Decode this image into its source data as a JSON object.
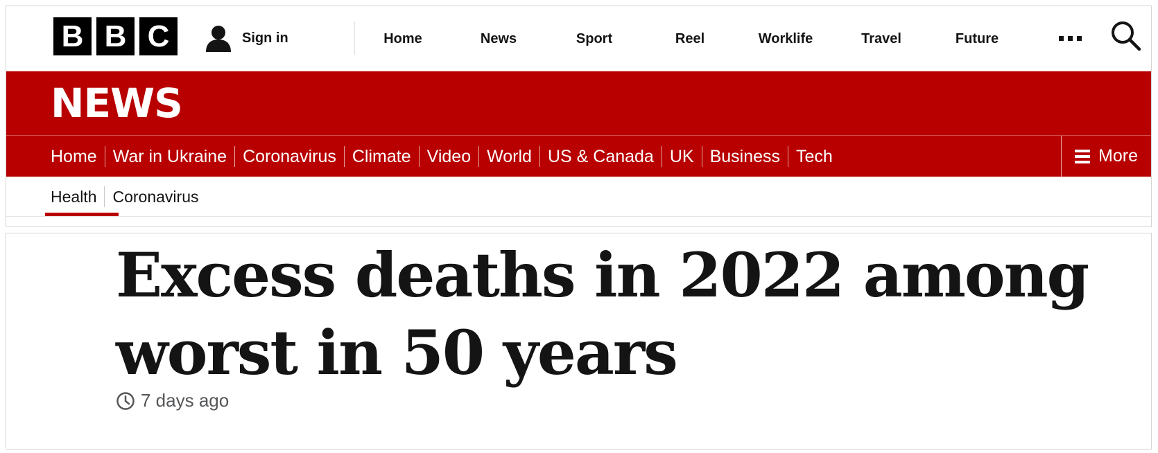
{
  "global_header": {
    "logo_letters": [
      "B",
      "B",
      "C"
    ],
    "sign_in_label": "Sign in",
    "nav_items": [
      "Home",
      "News",
      "Sport",
      "Reel",
      "Worklife",
      "Travel",
      "Future"
    ],
    "more_icon": "ellipsis-icon",
    "search_icon": "search-icon",
    "user_icon": "user-icon"
  },
  "news_header": {
    "title": "NEWS",
    "brand_color": "#b80000",
    "nav_items": [
      "Home",
      "War in Ukraine",
      "Coronavirus",
      "Climate",
      "Video",
      "World",
      "US & Canada",
      "UK",
      "Business",
      "Tech"
    ],
    "more_label": "More",
    "more_icon": "hamburger-icon"
  },
  "sub_nav": {
    "items": [
      "Health",
      "Coronavirus"
    ],
    "active": "Health"
  },
  "article": {
    "headline": "Excess deaths in 2022 among worst in 50 years",
    "timestamp": "7 days ago",
    "timestamp_icon": "clock-icon"
  }
}
